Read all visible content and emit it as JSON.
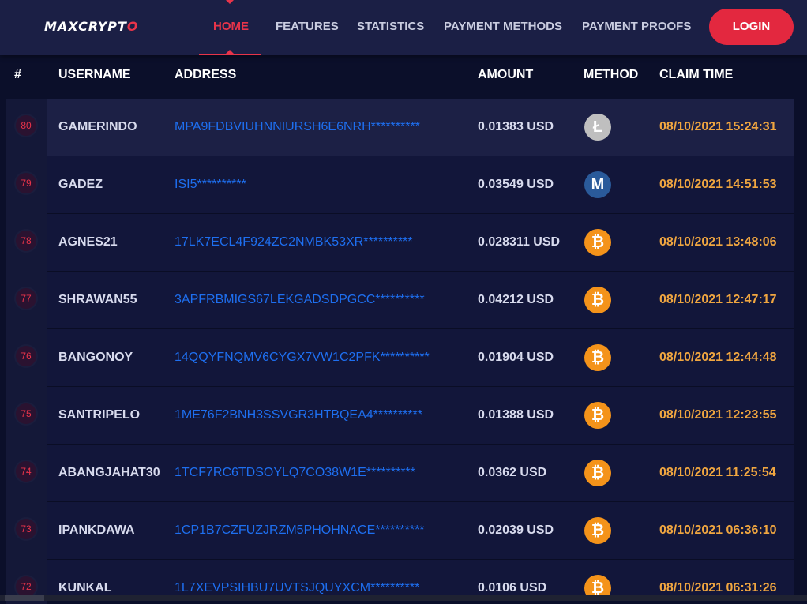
{
  "brand": {
    "logo_main": "MAXCRYPT",
    "logo_accent": "O"
  },
  "nav": {
    "items": [
      "HOME",
      "FEATURES",
      "STATISTICS",
      "PAYMENT METHODS",
      "PAYMENT PROOFS"
    ],
    "active": "HOME",
    "login_label": "LOGIN"
  },
  "table": {
    "headers": [
      "#",
      "USERNAME",
      "ADDRESS",
      "AMOUNT",
      "METHOD",
      "CLAIM TIME"
    ],
    "rows": [
      {
        "rank": "80",
        "username": "GAMERINDO",
        "address": "MPA9FDBVIUHNNIURSH6E6NRH**********",
        "amount": "0.01383 USD",
        "method": "litecoin-icon",
        "method_glyph": "Ł",
        "claim_time": "08/10/2021 15:24:31"
      },
      {
        "rank": "79",
        "username": "GADEZ",
        "address": "ISI5**********",
        "amount": "0.03549 USD",
        "method": "monero-icon",
        "method_glyph": "M",
        "claim_time": "08/10/2021 14:51:53"
      },
      {
        "rank": "78",
        "username": "AGNES21",
        "address": "17LK7ECL4F924ZC2NMBK53XR**********",
        "amount": "0.028311 USD",
        "method": "bitcoin-icon",
        "method_glyph": "₿",
        "claim_time": "08/10/2021 13:48:06"
      },
      {
        "rank": "77",
        "username": "SHRAWAN55",
        "address": "3APFRBMIGS67LEKGADSDPGCC**********",
        "amount": "0.04212 USD",
        "method": "bitcoin-icon",
        "method_glyph": "₿",
        "claim_time": "08/10/2021 12:47:17"
      },
      {
        "rank": "76",
        "username": "BANGONOY",
        "address": "14QQYFNQMV6CYGX7VW1C2PFK**********",
        "amount": "0.01904 USD",
        "method": "bitcoin-icon",
        "method_glyph": "₿",
        "claim_time": "08/10/2021 12:44:48"
      },
      {
        "rank": "75",
        "username": "SANTRIPELO",
        "address": "1ME76F2BNH3SSVGR3HTBQEA4**********",
        "amount": "0.01388 USD",
        "method": "bitcoin-icon",
        "method_glyph": "₿",
        "claim_time": "08/10/2021 12:23:55"
      },
      {
        "rank": "74",
        "username": "ABANGJAHAT30",
        "address": "1TCF7RC6TDSOYLQ7CO38W1E**********",
        "amount": "0.0362 USD",
        "method": "bitcoin-icon",
        "method_glyph": "₿",
        "claim_time": "08/10/2021 11:25:54"
      },
      {
        "rank": "73",
        "username": "IPANKDAWA",
        "address": "1CP1B7CZFUZJRZM5PHOHNACE**********",
        "amount": "0.02039 USD",
        "method": "bitcoin-icon",
        "method_glyph": "₿",
        "claim_time": "08/10/2021 06:36:10"
      },
      {
        "rank": "72",
        "username": "KUNKAL",
        "address": "1L7XEVPSIHBU7UVTSJQUYXCM**********",
        "amount": "0.0106 USD",
        "method": "bitcoin-icon",
        "method_glyph": "₿",
        "claim_time": "08/10/2021 06:31:26"
      }
    ]
  },
  "colors": {
    "accent": "#e8344a",
    "address": "#1e6ff0",
    "claim_time": "#f0a640",
    "bitcoin": "#f4931a",
    "litecoin": "#bfbfbf",
    "monero": "#2a5a9a"
  }
}
